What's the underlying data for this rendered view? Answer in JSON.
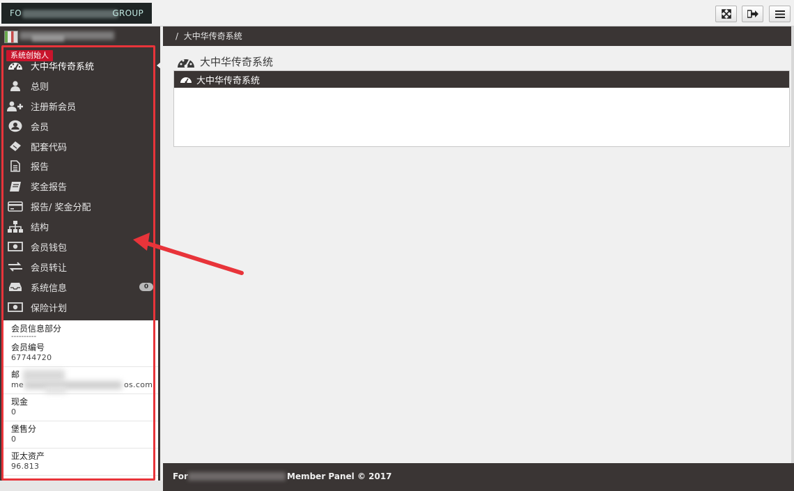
{
  "topbar": {
    "logo_prefix": "FO",
    "logo_suffix": "GROUP",
    "buttons": [
      {
        "name": "fullscreen-button",
        "icon": "expand-icon",
        "glyph": "⤧"
      },
      {
        "name": "logout-button",
        "icon": "sign-out-icon",
        "glyph": "➜"
      },
      {
        "name": "menu-button",
        "icon": "hamburger-icon",
        "glyph": "≡"
      }
    ]
  },
  "sidebar": {
    "founder_badge": "系统创始人",
    "items": [
      {
        "label": "大中华传奇系统",
        "icon": "dashboard-icon",
        "active": true
      },
      {
        "label": "总则",
        "icon": "user-icon"
      },
      {
        "label": "注册新会员",
        "icon": "user-plus-icon"
      },
      {
        "label": "会员",
        "icon": "user-circle-icon"
      },
      {
        "label": "配套代码",
        "icon": "ticket-icon"
      },
      {
        "label": "报告",
        "icon": "file-text-icon"
      },
      {
        "label": "奖金报告",
        "icon": "book-icon"
      },
      {
        "label": "报告/ 奖金分配",
        "icon": "credit-card-icon"
      },
      {
        "label": "结构",
        "icon": "sitemap-icon"
      },
      {
        "label": "会员钱包",
        "icon": "money-icon"
      },
      {
        "label": "会员转让",
        "icon": "exchange-icon"
      },
      {
        "label": "系统信息",
        "icon": "inbox-icon",
        "badge": "0"
      },
      {
        "label": "保险计划",
        "icon": "money-icon"
      }
    ]
  },
  "member_info": {
    "section_title": "会员信息部分",
    "divider": "----------",
    "member_id_label": "会员编号",
    "member_id": "67744720",
    "email_label": "邮",
    "email_prefix": "me",
    "email_suffix": "os.com",
    "cash_label": "现金",
    "cash": "0",
    "sales_label": "堡售分",
    "sales": "0",
    "asia_label": "亚太资产",
    "asia": "96.813"
  },
  "breadcrumb": {
    "separator": "/",
    "current": "大中华传奇系统"
  },
  "main": {
    "title": "大中华传奇系统",
    "panel_title": "大中华传奇系统"
  },
  "footer": {
    "prefix": "For",
    "suffix": "Member Panel © 2017"
  },
  "colors": {
    "dark": "#3a3534",
    "badge_red": "#c9142c",
    "annotation_red": "#e8343a"
  }
}
